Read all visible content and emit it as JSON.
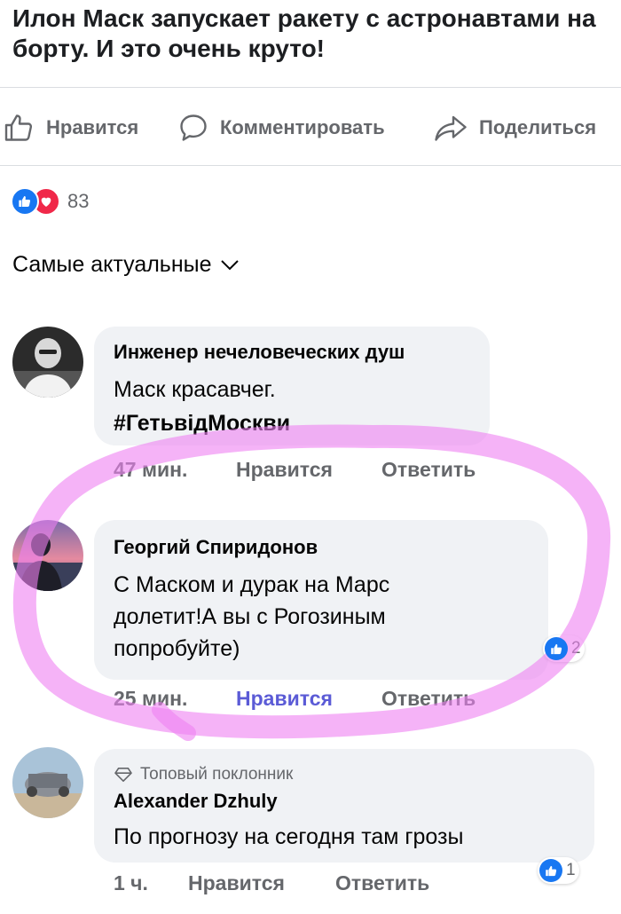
{
  "post": {
    "title": "Илон Маск запускает ракету с астронавтами на борту. И это очень круто!"
  },
  "actions": {
    "like_label": "Нравится",
    "comment_label": "Комментировать",
    "share_label": "Поделиться"
  },
  "reactions": {
    "count": "83",
    "types": [
      "like",
      "love"
    ]
  },
  "sort": {
    "label": "Самые актуальные"
  },
  "comments": [
    {
      "author": "Инженер нечеловеческих душ",
      "text_line1": "Маск красавчег.",
      "text_line2": "#ГетьвідМоскви",
      "time": "47 мин.",
      "like_label": "Нравится",
      "reply_label": "Ответить"
    },
    {
      "author": "Георгий Спиридонов",
      "text_line1": "С Маском и дурак на Марс",
      "text_line2": "долетит!А вы с Рогозиным",
      "text_line3": "попробуйте)",
      "time": "25 мин.",
      "like_label": "Нравится",
      "reply_label": "Ответить",
      "reaction_count": "2"
    },
    {
      "badge": "Топовый поклонник",
      "author": "Alexander Dzhuly",
      "text_line1": "По прогнозу на сегодня там грозы",
      "time": "1 ч.",
      "like_label": "Нравится",
      "reply_label": "Ответить",
      "reaction_count": "1"
    }
  ],
  "colors": {
    "like_blue": "#1877f2",
    "love_red": "#f02849",
    "meta_gray": "#65676b",
    "bubble_bg": "#f0f2f5",
    "highlight_stroke": "#ee80f2"
  }
}
